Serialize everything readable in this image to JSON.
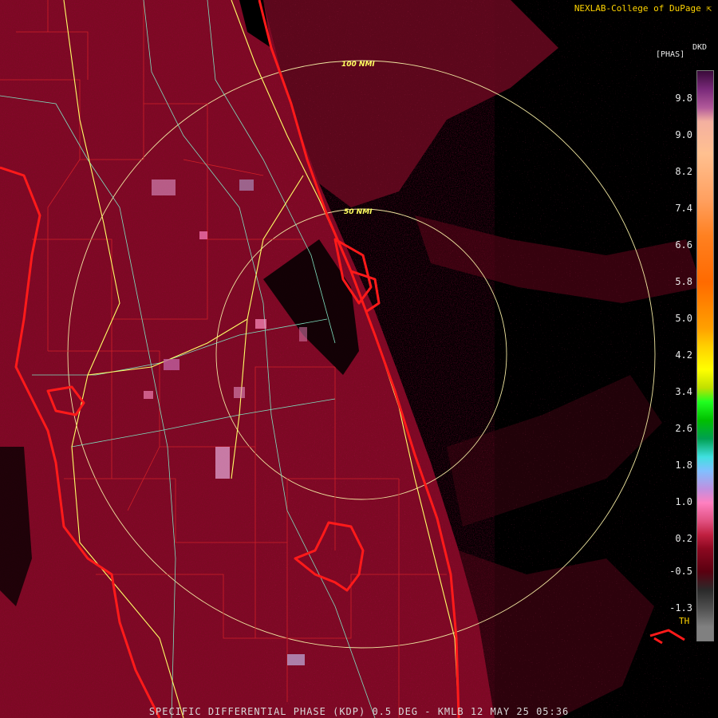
{
  "header": {
    "credit": "NEXLAB-College of DuPage ⇱"
  },
  "range_rings": [
    "100 NMI",
    "50 NMI"
  ],
  "legend": {
    "unit_top": "DKD",
    "unit_sub": "[PHAS]",
    "ticks": [
      "9.8",
      "9.0",
      "8.2",
      "7.4",
      "6.6",
      "5.8",
      "5.0",
      "4.2",
      "3.4",
      "2.6",
      "1.8",
      "1.0",
      "0.2",
      "-0.5",
      "-1.3"
    ],
    "tick_values": [
      9.8,
      9.0,
      8.2,
      7.4,
      6.6,
      5.8,
      5.0,
      4.2,
      3.4,
      2.6,
      1.8,
      1.0,
      0.2,
      -0.5,
      -1.3
    ],
    "range": [
      -2.0,
      10.4
    ],
    "threshold_label": "TH",
    "color_stops": [
      {
        "v": 10.4,
        "c": "#3a0a3a"
      },
      {
        "v": 10.0,
        "c": "#7a2a7a"
      },
      {
        "v": 9.6,
        "c": "#b25a9a"
      },
      {
        "v": 9.3,
        "c": "#f4b0a0"
      },
      {
        "v": 8.6,
        "c": "#ffc090"
      },
      {
        "v": 7.6,
        "c": "#ffa060"
      },
      {
        "v": 6.8,
        "c": "#ff8020"
      },
      {
        "v": 5.8,
        "c": "#ff6a00"
      },
      {
        "v": 4.8,
        "c": "#ffa000"
      },
      {
        "v": 4.4,
        "c": "#ffd000"
      },
      {
        "v": 3.9,
        "c": "#ffff00"
      },
      {
        "v": 3.5,
        "c": "#c0e000"
      },
      {
        "v": 3.2,
        "c": "#20ff20"
      },
      {
        "v": 2.8,
        "c": "#00c000"
      },
      {
        "v": 2.4,
        "c": "#00a050"
      },
      {
        "v": 2.0,
        "c": "#40e0e0"
      },
      {
        "v": 1.7,
        "c": "#80c0ff"
      },
      {
        "v": 1.3,
        "c": "#c090e0"
      },
      {
        "v": 1.0,
        "c": "#ff80c0"
      },
      {
        "v": 0.6,
        "c": "#e05080"
      },
      {
        "v": 0.3,
        "c": "#c02040"
      },
      {
        "v": 0.0,
        "c": "#8c0820"
      },
      {
        "v": -0.5,
        "c": "#5a0010"
      },
      {
        "v": -0.9,
        "c": "#2a2a2a"
      },
      {
        "v": -1.3,
        "c": "#505050"
      },
      {
        "v": -1.7,
        "c": "#808080"
      },
      {
        "v": -2.0,
        "c": "#808080"
      }
    ]
  },
  "colors": {
    "echo": "#7a0a22",
    "echo_dark": "#5a0018",
    "coast": "#ff1a1a",
    "county": "#d02028",
    "highway": "#ffff66",
    "road": "#7fe0c0",
    "ring": "#f0e6a0"
  },
  "footer": {
    "caption": "SPECIFIC DIFFERENTIAL PHASE (KDP) 0.5 DEG - KMLB 12 MAY 25 05:36"
  }
}
